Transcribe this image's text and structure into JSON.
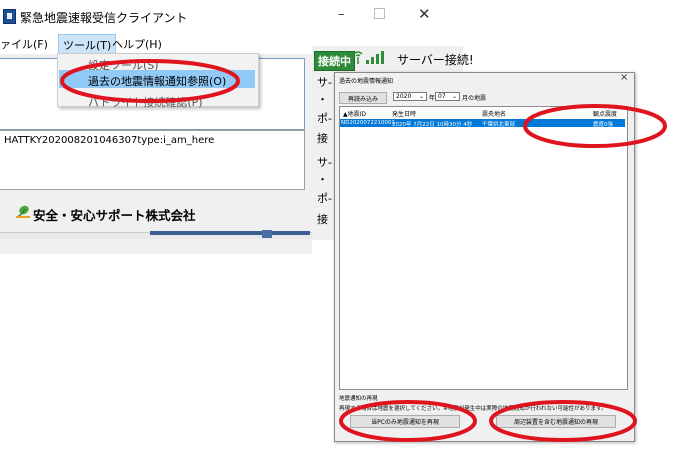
{
  "window": {
    "title": "緊急地震速報受信クライアント",
    "minimize": "–",
    "close": "✕",
    "icon": "app-icon"
  },
  "menu": {
    "file": "ァイル(F)",
    "tool": "ツール(T)",
    "help": "ヘルプ(H)"
  },
  "dropdown": {
    "items": [
      "設定ツール(S)",
      "過去の地震情報通知参照(O)",
      "パトライト接続確認(P)"
    ]
  },
  "main": {
    "log_text": "HATTKY202008201046307type:i_am_here",
    "company": "安全・安心サポート株式会社",
    "company_icon": "leaf-logo-icon"
  },
  "status": {
    "badge": "接続中",
    "signal_icon": "signal-bars-icon",
    "server_text": "サーバー接続!",
    "side_labels": [
      "サ-",
      "・",
      "ポ-",
      "接",
      "サ-",
      "・",
      "ポ-",
      "接"
    ]
  },
  "dialog": {
    "title": "過去の地震情報通知",
    "close": "×",
    "reload": "再読み込み",
    "year": "2020",
    "year_label": "年",
    "month": "07",
    "month_label": "月の地震",
    "columns": [
      "▲地震ID",
      "発生日時",
      "震央地名",
      "観点震度"
    ],
    "rows": [
      [
        "ND2020072210001",
        "2020年 7月22日 10時30分 4秒",
        "千葉県北東部",
        "震度0強"
      ]
    ],
    "note1": "地震通知の再現",
    "note2": "再現する場合は地震を選択してください。※地震が発生中は実際の地震通知が行われない可能性があります。",
    "btn_pc_only": "当PCのみ地震通知を再現",
    "btn_with_peripherals": "周辺装置を含む地震通知の再現"
  },
  "colors": {
    "highlight": "#91c9f7",
    "selection": "#0078d7",
    "annotation": "#e0141e",
    "status_green": "#2e8b3a"
  }
}
